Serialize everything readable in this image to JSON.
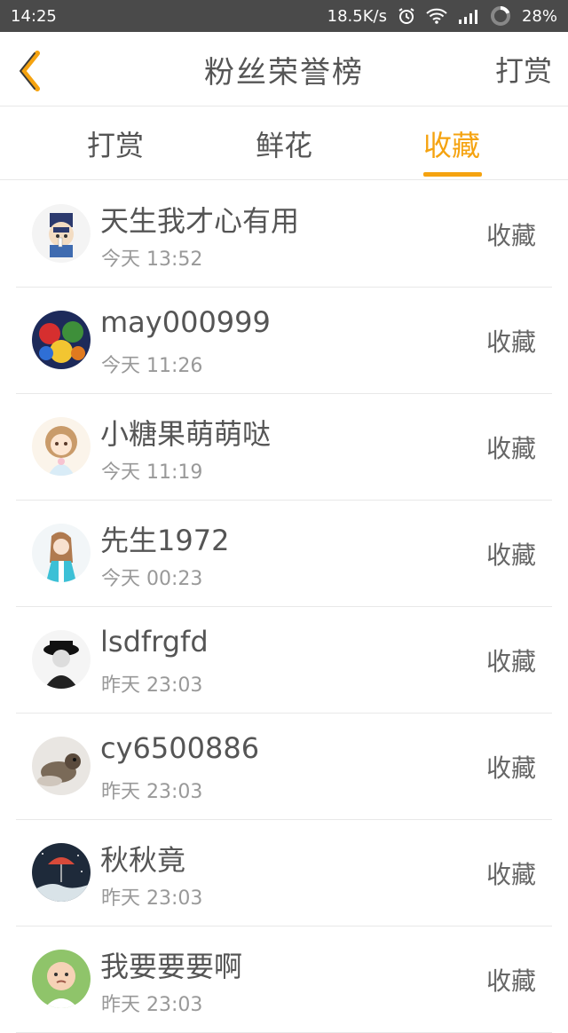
{
  "status_bar": {
    "time": "14:25",
    "speed": "18.5K/s",
    "battery": "28%",
    "icons": [
      "alarm-icon",
      "wifi-icon",
      "signal-icon",
      "battery-icon"
    ]
  },
  "header": {
    "back_icon": "chevron-left-icon",
    "title": "粉丝荣誉榜",
    "action": "打赏"
  },
  "tabs": [
    {
      "label": "打赏",
      "active": false
    },
    {
      "label": "鲜花",
      "active": false
    },
    {
      "label": "收藏",
      "active": true
    }
  ],
  "colors": {
    "accent": "#f5a310",
    "status_bar": "#4a4a4a",
    "text": "#555555",
    "subtext": "#999999",
    "divider": "#e8e8e8"
  },
  "list": [
    {
      "name": "天生我才心有用",
      "time": "今天 13:52",
      "action": "收藏"
    },
    {
      "name": "may000999",
      "time": "今天 11:26",
      "action": "收藏"
    },
    {
      "name": "小糖果萌萌哒",
      "time": "今天 11:19",
      "action": "收藏"
    },
    {
      "name": "先生1972",
      "time": "今天 00:23",
      "action": "收藏"
    },
    {
      "name": "lsdfrgfd",
      "time": "昨天 23:03",
      "action": "收藏"
    },
    {
      "name": "cy6500886",
      "time": "昨天 23:03",
      "action": "收藏"
    },
    {
      "name": "秋秋竟",
      "time": "昨天 23:03",
      "action": "收藏"
    },
    {
      "name": "我要要要啊",
      "time": "昨天 23:03",
      "action": "收藏"
    }
  ]
}
